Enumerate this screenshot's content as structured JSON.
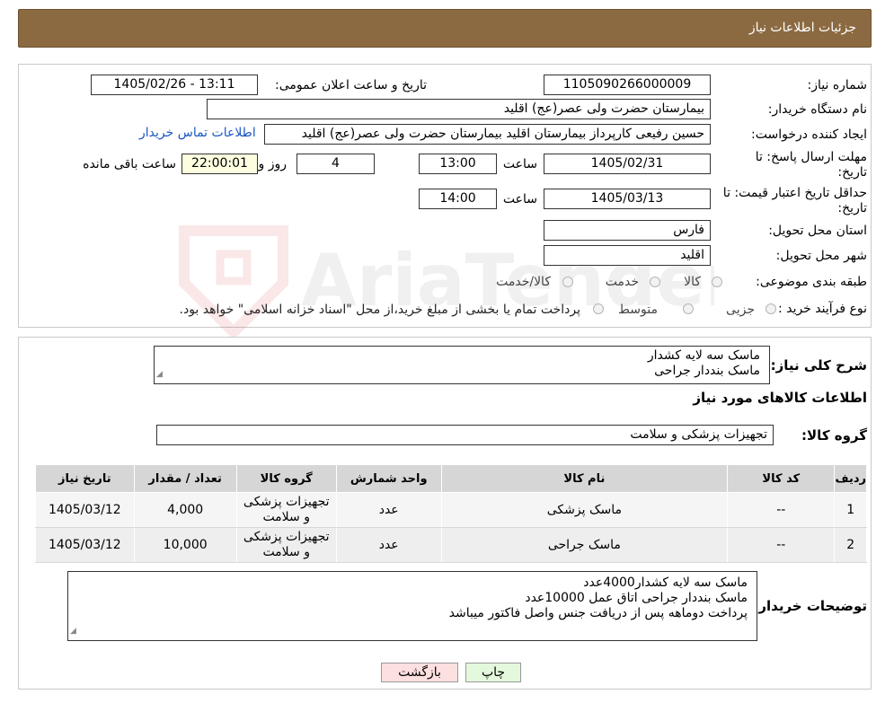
{
  "header": {
    "title": "جزئیات اطلاعات نیاز"
  },
  "watermark": "AriaTender.neT",
  "form": {
    "need_number_label": "شماره نیاز:",
    "need_number": "1105090266000009",
    "announce_label": "تاریخ و ساعت اعلان عمومی:",
    "announce_value": "1405/02/26 - 13:11",
    "buyer_org_label": "نام دستگاه خریدار:",
    "buyer_org": "بیمارستان حضرت ولی عصر(عج) اقلید",
    "creator_label": "ایجاد کننده درخواست:",
    "creator": "حسین رفیعی کارپرداز بیمارستان اقلید بیمارستان حضرت ولی عصر(عج) اقلید",
    "contact_link": "اطلاعات تماس خریدار",
    "deadline_label_1": "مهلت ارسال پاسخ: تا",
    "deadline_label_2": "تاریخ:",
    "deadline_date": "1405/02/31",
    "time_label": "ساعت",
    "deadline_time": "13:00",
    "days": "4",
    "days_label": "روز و",
    "remaining_time": "22:00:01",
    "remaining_label": "ساعت باقی مانده",
    "validity_label_1": "حداقل تاریخ اعتبار قیمت: تا",
    "validity_label_2": "تاریخ:",
    "validity_date": "1405/03/13",
    "validity_time": "14:00",
    "province_label": "استان محل تحویل:",
    "province": "فارس",
    "city_label": "شهر محل تحویل:",
    "city": "اقلید",
    "category_label": "طبقه بندی موضوعی:",
    "category_options": [
      "کالا",
      "خدمت",
      "کالا/خدمت"
    ],
    "process_label": "نوع فرآیند خرید :",
    "process_options": [
      "جزیی",
      "متوسط"
    ],
    "payment_note": "پرداخت تمام یا بخشی از مبلغ خرید،از محل \"اسناد خزانه اسلامی\" خواهد بود."
  },
  "summary": {
    "label": "شرح کلی نیاز:",
    "lines": [
      "ماسک سه لایه کشدار",
      "ماسک بنددار جراحی"
    ]
  },
  "items_section": {
    "title": "اطلاعات کالاهای مورد نیاز",
    "group_label": "گروه کالا:",
    "group_value": "تجهیزات پزشکی و سلامت"
  },
  "table": {
    "headers": [
      "ردیف",
      "کد کالا",
      "نام کالا",
      "واحد شمارش",
      "گروه کالا",
      "تعداد / مقدار",
      "تاریخ نیاز"
    ],
    "rows": [
      [
        "1",
        "--",
        "ماسک پزشکی",
        "عدد",
        "تجهیزات پزشکی و سلامت",
        "4,000",
        "1405/03/12"
      ],
      [
        "2",
        "--",
        "ماسک جراحی",
        "عدد",
        "تجهیزات پزشکی و سلامت",
        "10,000",
        "1405/03/12"
      ]
    ]
  },
  "buyer_notes": {
    "label": "توضیحات خریدار:",
    "lines": [
      "ماسک سه لایه کشدار4000عدد",
      "ماسک بنددار جراحی اتاق عمل 10000عدد",
      "پرداخت دوماهه پس از دریافت جنس واصل فاکتور میباشد"
    ]
  },
  "buttons": {
    "print": "چاپ",
    "back": "بازگشت"
  },
  "colors": {
    "header_bg": "#8c6a41",
    "link": "#1a56c4",
    "back_btn": "#fde0e0",
    "print_btn": "#e4f8dc"
  }
}
